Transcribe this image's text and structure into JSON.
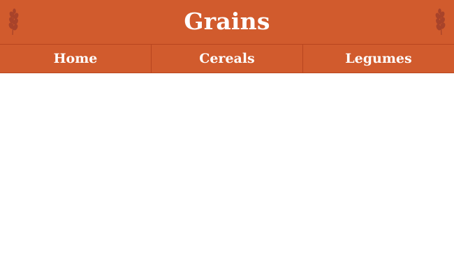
{
  "header": {
    "title": "Grains",
    "left_icon": "wheat-icon",
    "right_icon": "wheat-icon"
  },
  "nav": {
    "items": [
      {
        "label": "Home"
      },
      {
        "label": "Cereals"
      },
      {
        "label": "Legumes"
      }
    ]
  },
  "colors": {
    "brand": "#d15b2d",
    "icon": "#a8432a",
    "text": "#ffffff",
    "background": "#ffffff"
  }
}
